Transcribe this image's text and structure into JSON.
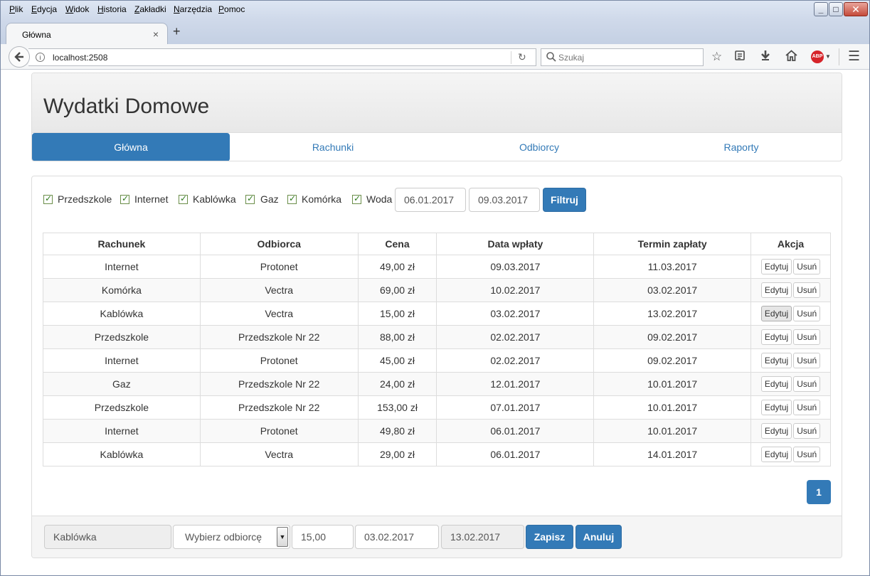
{
  "browser": {
    "menu": [
      {
        "key": "P",
        "rest": "lik"
      },
      {
        "key": "E",
        "rest": "dycja"
      },
      {
        "key": "W",
        "rest": "idok"
      },
      {
        "key": "H",
        "rest": "istoria"
      },
      {
        "key": "Z",
        "rest": "akładki"
      },
      {
        "key": "N",
        "rest": "arzędzia"
      },
      {
        "key": "P",
        "rest": "omoc"
      }
    ],
    "tab_title": "Główna",
    "tab_close": "×",
    "new_tab": "+",
    "url": "localhost:2508",
    "search_placeholder": "Szukaj",
    "abp_label": "ABP"
  },
  "app": {
    "title": "Wydatki Domowe",
    "nav": [
      "Główna",
      "Rachunki",
      "Odbiorcy",
      "Raporty"
    ],
    "active_nav": "Główna"
  },
  "filters": {
    "categories": [
      "Przedszkole",
      "Internet",
      "Kablówka",
      "Gaz",
      "Komórka",
      "Woda"
    ],
    "checked": [
      true,
      true,
      true,
      true,
      true,
      true
    ],
    "date_from": "06.01.2017",
    "date_to": "09.03.2017",
    "filter_button": "Filtruj"
  },
  "table": {
    "headers": [
      "Rachunek",
      "Odbiorca",
      "Cena",
      "Data wpłaty",
      "Termin zapłaty",
      "Akcja"
    ],
    "edit_label": "Edytuj",
    "delete_label": "Usuń",
    "rows": [
      [
        "Internet",
        "Protonet",
        "49,00 zł",
        "09.03.2017",
        "11.03.2017"
      ],
      [
        "Komórka",
        "Vectra",
        "69,00 zł",
        "10.02.2017",
        "03.02.2017"
      ],
      [
        "Kablówka",
        "Vectra",
        "15,00 zł",
        "03.02.2017",
        "13.02.2017"
      ],
      [
        "Przedszkole",
        "Przedszkole Nr 22",
        "88,00 zł",
        "02.02.2017",
        "09.02.2017"
      ],
      [
        "Internet",
        "Protonet",
        "45,00 zł",
        "02.02.2017",
        "09.02.2017"
      ],
      [
        "Gaz",
        "Przedszkole Nr 22",
        "24,00 zł",
        "12.01.2017",
        "10.01.2017"
      ],
      [
        "Przedszkole",
        "Przedszkole Nr 22",
        "153,00 zł",
        "07.01.2017",
        "10.01.2017"
      ],
      [
        "Internet",
        "Protonet",
        "49,80 zł",
        "06.01.2017",
        "10.01.2017"
      ],
      [
        "Kablówka",
        "Vectra",
        "29,00 zł",
        "06.01.2017",
        "14.01.2017"
      ]
    ]
  },
  "pagination": {
    "current": "1"
  },
  "edit_form": {
    "bill": "Kablówka",
    "recipient_placeholder": "Wybierz odbiorcę",
    "price": "15,00",
    "payment_date": "03.02.2017",
    "due_date": "13.02.2017",
    "save_button": "Zapisz",
    "cancel_button": "Anuluj"
  }
}
